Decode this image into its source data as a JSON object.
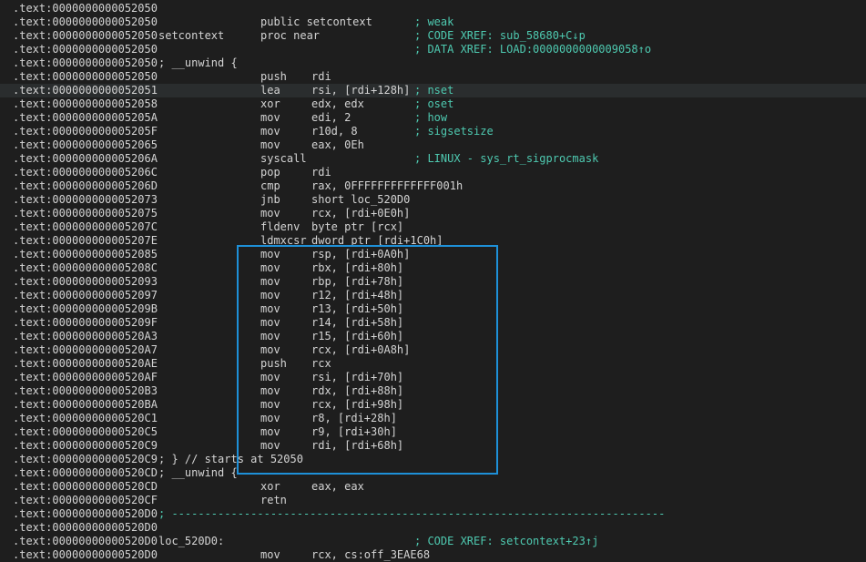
{
  "rows": [
    {
      "addr": ".text:0000000000052050"
    },
    {
      "addr": ".text:0000000000052050",
      "mnem": "public setcontext",
      "cmt": "; weak"
    },
    {
      "addr": ".text:0000000000052050",
      "label": "setcontext",
      "mnem": "proc near",
      "cmt": "; CODE XREF: sub_58680+C↓p"
    },
    {
      "addr": ".text:0000000000052050",
      "cmt": "; DATA XREF: LOAD:0000000000009058↑o"
    },
    {
      "addr": ".text:0000000000052050",
      "wide": "; __unwind {"
    },
    {
      "addr": ".text:0000000000052050",
      "mnem": "push",
      "ops": "rdi"
    },
    {
      "addr": ".text:0000000000052051",
      "mnem": "lea",
      "ops": "rsi, [rdi+128h]",
      "cmt": "; nset",
      "hl": true
    },
    {
      "addr": ".text:0000000000052058",
      "mnem": "xor",
      "ops": "edx, edx",
      "cmt": "; oset"
    },
    {
      "addr": ".text:000000000005205A",
      "mnem": "mov",
      "ops": "edi, 2",
      "cmt": "; how"
    },
    {
      "addr": ".text:000000000005205F",
      "mnem": "mov",
      "ops": "r10d, 8",
      "cmt": "; sigsetsize"
    },
    {
      "addr": ".text:0000000000052065",
      "mnem": "mov",
      "ops": "eax, 0Eh"
    },
    {
      "addr": ".text:000000000005206A",
      "mnem": "syscall",
      "cmt": "; LINUX - sys_rt_sigprocmask"
    },
    {
      "addr": ".text:000000000005206C",
      "mnem": "pop",
      "ops": "rdi"
    },
    {
      "addr": ".text:000000000005206D",
      "mnem": "cmp",
      "ops": "rax, 0FFFFFFFFFFFFF001h"
    },
    {
      "addr": ".text:0000000000052073",
      "mnem": "jnb",
      "ops": "short loc_520D0"
    },
    {
      "addr": ".text:0000000000052075",
      "mnem": "mov",
      "ops": "rcx, [rdi+0E0h]"
    },
    {
      "addr": ".text:000000000005207C",
      "mnem": "fldenv",
      "ops": "byte ptr [rcx]"
    },
    {
      "addr": ".text:000000000005207E",
      "mnem": "ldmxcsr",
      "ops": "dword ptr [rdi+1C0h]"
    },
    {
      "addr": ".text:0000000000052085",
      "mnem": "mov",
      "ops": "rsp, [rdi+0A0h]"
    },
    {
      "addr": ".text:000000000005208C",
      "mnem": "mov",
      "ops": "rbx, [rdi+80h]"
    },
    {
      "addr": ".text:0000000000052093",
      "mnem": "mov",
      "ops": "rbp, [rdi+78h]"
    },
    {
      "addr": ".text:0000000000052097",
      "mnem": "mov",
      "ops": "r12, [rdi+48h]"
    },
    {
      "addr": ".text:000000000005209B",
      "mnem": "mov",
      "ops": "r13, [rdi+50h]"
    },
    {
      "addr": ".text:000000000005209F",
      "mnem": "mov",
      "ops": "r14, [rdi+58h]"
    },
    {
      "addr": ".text:00000000000520A3",
      "mnem": "mov",
      "ops": "r15, [rdi+60h]"
    },
    {
      "addr": ".text:00000000000520A7",
      "mnem": "mov",
      "ops": "rcx, [rdi+0A8h]"
    },
    {
      "addr": ".text:00000000000520AE",
      "mnem": "push",
      "ops": "rcx"
    },
    {
      "addr": ".text:00000000000520AF",
      "mnem": "mov",
      "ops": "rsi, [rdi+70h]"
    },
    {
      "addr": ".text:00000000000520B3",
      "mnem": "mov",
      "ops": "rdx, [rdi+88h]"
    },
    {
      "addr": ".text:00000000000520BA",
      "mnem": "mov",
      "ops": "rcx, [rdi+98h]"
    },
    {
      "addr": ".text:00000000000520C1",
      "mnem": "mov",
      "ops": "r8, [rdi+28h]"
    },
    {
      "addr": ".text:00000000000520C5",
      "mnem": "mov",
      "ops": "r9, [rdi+30h]"
    },
    {
      "addr": ".text:00000000000520C9",
      "mnem": "mov",
      "ops": "rdi, [rdi+68h]"
    },
    {
      "addr": ".text:00000000000520C9",
      "wide": "; } // starts at 52050"
    },
    {
      "addr": ".text:00000000000520CD",
      "wide": "; __unwind {"
    },
    {
      "addr": ".text:00000000000520CD",
      "mnem": "xor",
      "ops": "eax, eax"
    },
    {
      "addr": ".text:00000000000520CF",
      "mnem": "retn"
    },
    {
      "addr": ".text:00000000000520D0",
      "sep": "; ---------------------------------------------------------------------------"
    },
    {
      "addr": ".text:00000000000520D0"
    },
    {
      "addr": ".text:00000000000520D0",
      "label": "loc_520D0:",
      "cmt": "; CODE XREF: setcontext+23↑j"
    },
    {
      "addr": ".text:00000000000520D0",
      "mnem": "mov",
      "ops": "rcx, cs:off_3EAE68"
    }
  ],
  "colors": {
    "background": "#1e1e1e",
    "text": "#d4d4d4",
    "comment": "#4ec9b0",
    "selection_border": "#1e90d8",
    "current_line": "#2a2d2e"
  }
}
